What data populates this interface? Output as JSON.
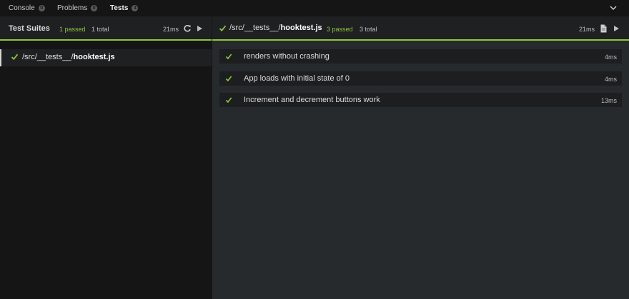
{
  "tabs": [
    {
      "label": "Console",
      "badge": "0"
    },
    {
      "label": "Problems",
      "badge": "0"
    },
    {
      "label": "Tests",
      "badge": "4"
    }
  ],
  "suites_panel": {
    "title": "Test Suites",
    "passed": "1 passed",
    "total": "1 total",
    "duration": "21ms",
    "icons": [
      "refresh-icon",
      "play-icon"
    ],
    "suites": [
      {
        "dir": "/src/__tests__/",
        "file": "hooktest.js",
        "status": "passed"
      }
    ]
  },
  "detail_panel": {
    "dir": "/src/__tests__/",
    "file": "hooktest.js",
    "passed": "3 passed",
    "total": "3 total",
    "duration": "21ms",
    "icons": [
      "file-icon",
      "play-icon"
    ],
    "tests": [
      {
        "name": "renders without crashing",
        "duration": "4ms",
        "status": "passed"
      },
      {
        "name": "App loads with initial state of 0",
        "duration": "4ms",
        "status": "passed"
      },
      {
        "name": "Increment and decrement buttons work",
        "duration": "13ms",
        "status": "passed"
      }
    ]
  },
  "colors": {
    "accent_green": "#8dc63f",
    "panel_bg": "#1e2021",
    "content_bg": "#272a2c",
    "page_bg": "#151515"
  }
}
